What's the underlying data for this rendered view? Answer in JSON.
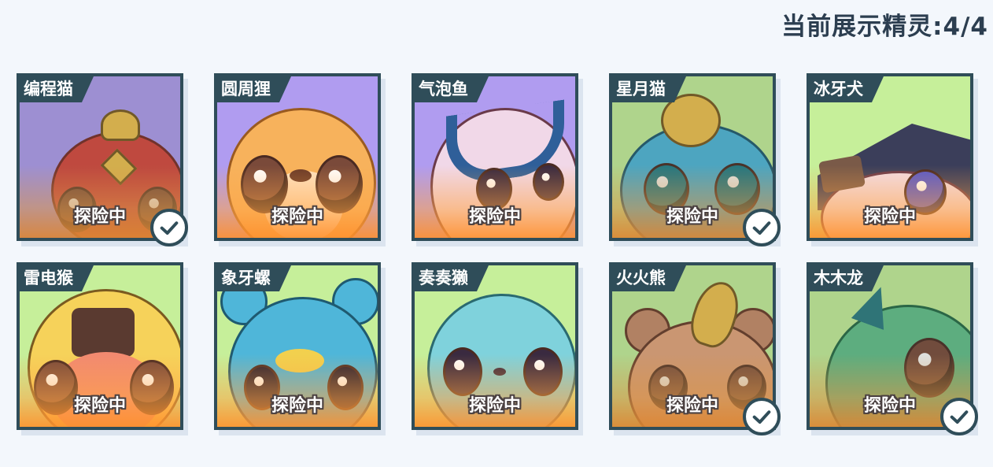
{
  "header": {
    "title": "当前展示精灵:4/4"
  },
  "status_label": "探险中",
  "colors": {
    "frame": "#2f4d59",
    "bg_purple": "#b09cf0",
    "bg_green": "#c6ef9a",
    "check_border": "#2f4d59"
  },
  "pets": [
    {
      "name": "编程猫",
      "status": "探险中",
      "background": "purple",
      "selected": true
    },
    {
      "name": "圆周狸",
      "status": "探险中",
      "background": "purple",
      "selected": false
    },
    {
      "name": "气泡鱼",
      "status": "探险中",
      "background": "purple",
      "selected": false
    },
    {
      "name": "星月猫",
      "status": "探险中",
      "background": "green",
      "selected": true
    },
    {
      "name": "冰牙犬",
      "status": "探险中",
      "background": "green",
      "selected": false
    },
    {
      "name": "雷电猴",
      "status": "探险中",
      "background": "green",
      "selected": false
    },
    {
      "name": "象牙螺",
      "status": "探险中",
      "background": "green",
      "selected": false
    },
    {
      "name": "奏奏獭",
      "status": "探险中",
      "background": "green",
      "selected": false
    },
    {
      "name": "火火熊",
      "status": "探险中",
      "background": "green",
      "selected": true
    },
    {
      "name": "木木龙",
      "status": "探险中",
      "background": "green",
      "selected": true
    }
  ]
}
